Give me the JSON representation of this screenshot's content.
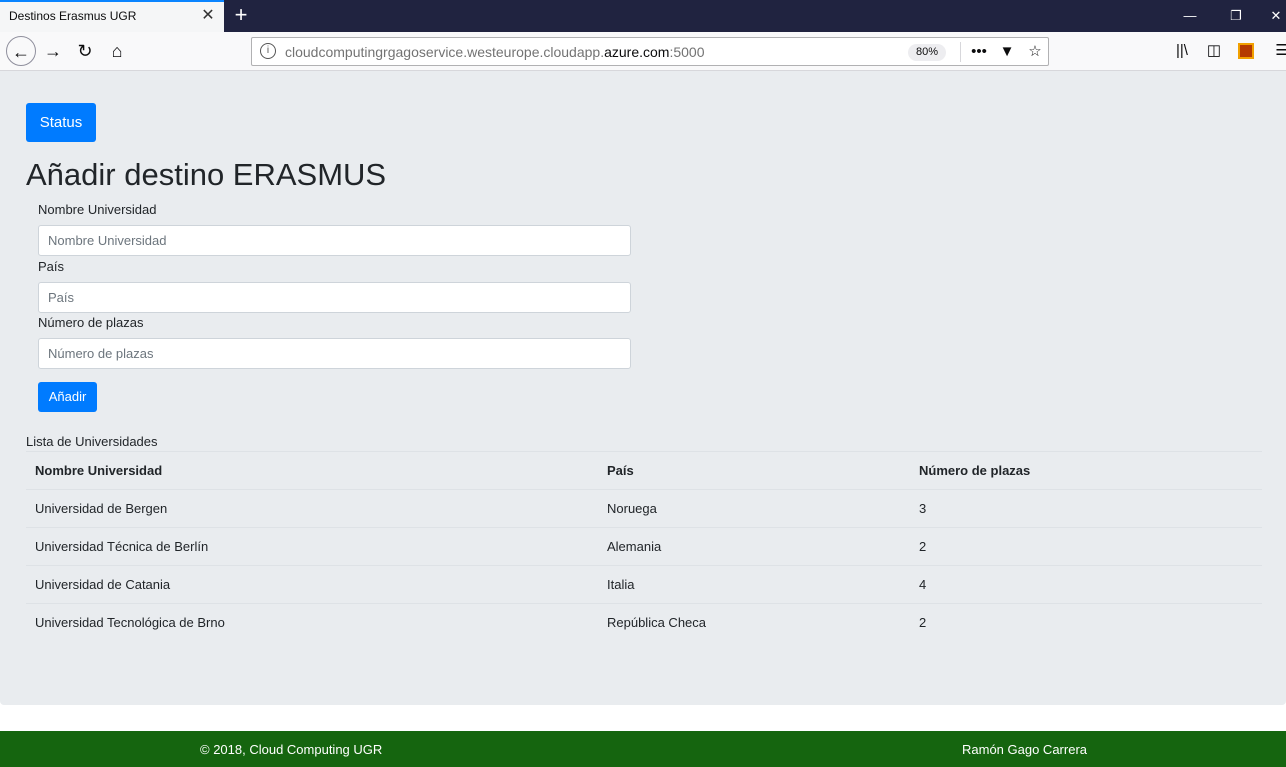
{
  "browser": {
    "tab_title": "Destinos Erasmus UGR",
    "tab_close_glyph": "✕",
    "new_tab_glyph": "+",
    "url_prefix": "cloudcomputingrgagoservice.westeurope.cloudapp.",
    "url_domain": "azure.com",
    "url_suffix": ":5000",
    "zoom": "80%",
    "page_actions_glyph": "•••",
    "icons": {
      "back": "back-arrow-icon",
      "forward": "forward-arrow-icon",
      "reload": "reload-icon",
      "home": "home-icon",
      "info": "info-icon",
      "pocket": "pocket-icon",
      "bookmark": "star-icon",
      "library": "library-icon",
      "sidebar": "sidebar-icon",
      "extension": "extension-icon",
      "menu": "hamburger-menu-icon"
    }
  },
  "page": {
    "status_button": "Status",
    "heading": "Añadir destino ERASMUS",
    "form": {
      "university_label": "Nombre Universidad",
      "university_placeholder": "Nombre Universidad",
      "country_label": "País",
      "country_placeholder": "País",
      "seats_label": "Número de plazas",
      "seats_placeholder": "Número de plazas",
      "submit_label": "Añadir"
    },
    "table": {
      "caption": "Lista de Universidades",
      "headers": [
        "Nombre Universidad",
        "País",
        "Número de plazas"
      ],
      "rows": [
        [
          "Universidad de Bergen",
          "Noruega",
          "3"
        ],
        [
          "Universidad Técnica de Berlín",
          "Alemania",
          "2"
        ],
        [
          "Universidad de Catania",
          "Italia",
          "4"
        ],
        [
          "Universidad Tecnológica de Brno",
          "República Checa",
          "2"
        ]
      ]
    },
    "footer": {
      "left": "© 2018, Cloud Computing UGR",
      "right": "Ramón Gago Carrera"
    }
  },
  "colors": {
    "primary": "#007bff",
    "footer_bg": "#15650f",
    "jumbotron_bg": "#e9ecef",
    "titlebar_bg": "#202340"
  }
}
